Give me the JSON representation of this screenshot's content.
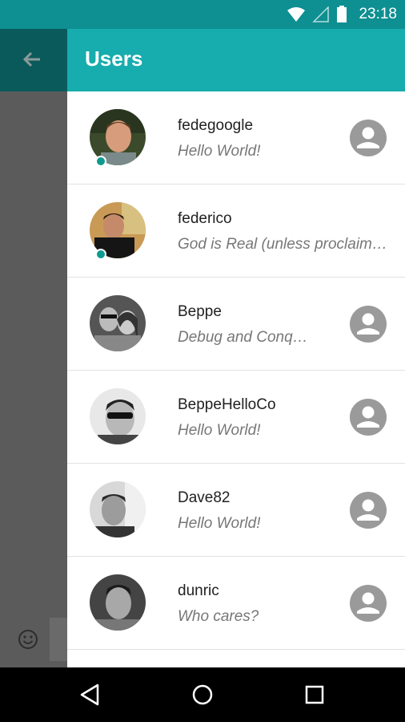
{
  "status_bar": {
    "time": "23:18"
  },
  "drawer": {
    "title": "Users"
  },
  "users": [
    {
      "name": "fedegoogle",
      "status": "Hello World!",
      "online": true,
      "has_profile_icon": true
    },
    {
      "name": "federico",
      "status": "God is Real (unless proclaimed integer)",
      "online": true,
      "has_profile_icon": false
    },
    {
      "name": "Beppe",
      "status": "Debug and Conquer",
      "online": false,
      "has_profile_icon": true
    },
    {
      "name": "BeppeHelloCo",
      "status": "Hello World!",
      "online": false,
      "has_profile_icon": true
    },
    {
      "name": "Dave82",
      "status": "Hello World!",
      "online": false,
      "has_profile_icon": true
    },
    {
      "name": "dunric",
      "status": "Who cares?",
      "online": false,
      "has_profile_icon": true
    }
  ],
  "colors": {
    "accent": "#17acad",
    "status_bar": "#0e8f91",
    "online": "#0e9b8f"
  },
  "icons": [
    "wifi-icon",
    "signal-icon",
    "battery-icon",
    "back-arrow-icon",
    "account-circle-icon",
    "smiley-icon",
    "nav-back-icon",
    "nav-home-icon",
    "nav-recents-icon"
  ]
}
